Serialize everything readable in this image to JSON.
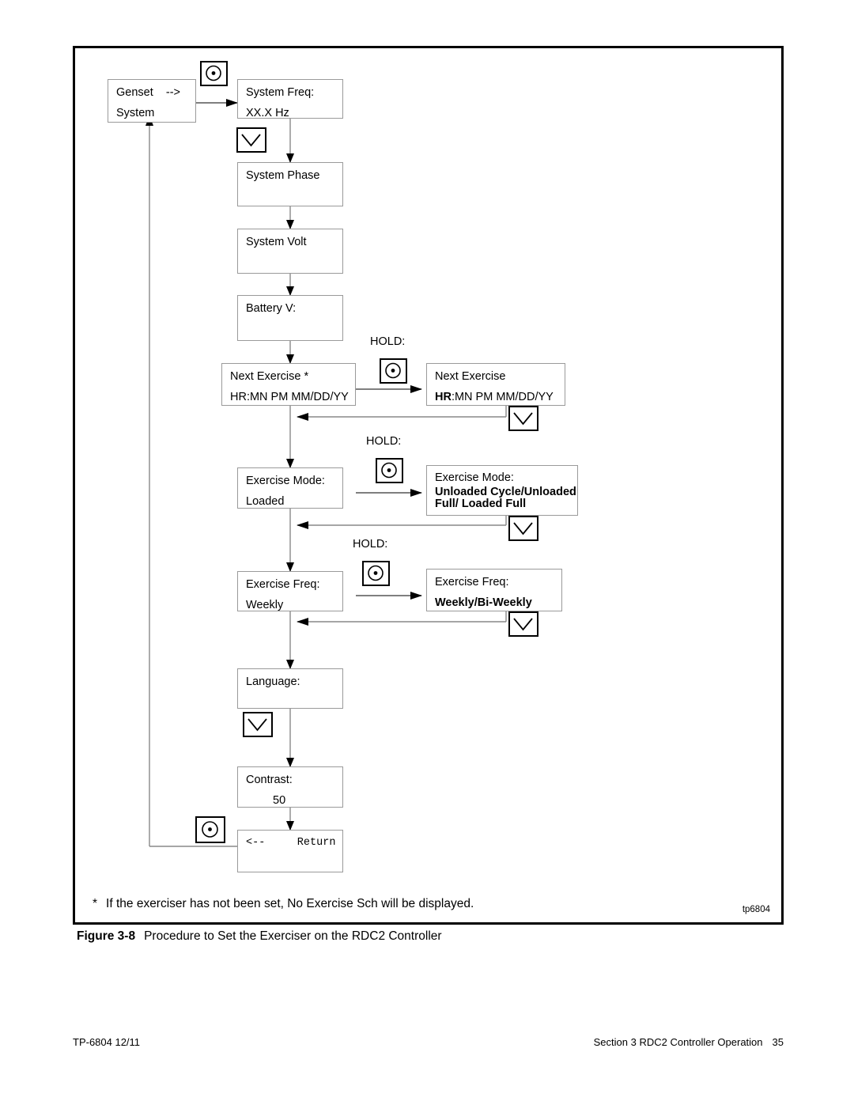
{
  "figure": {
    "caption_number": "Figure 3-8",
    "caption_text": "Procedure to Set the Exerciser on the RDC2 Controller",
    "drawing_id": "tp6804",
    "footnote_marker": "*",
    "footnote_text": "If the exerciser has not been set, No Exercise Sch will be displayed."
  },
  "footer": {
    "document_id": "TP-6804 12/11",
    "section": "Section 3  RDC2 Controller Operation",
    "page_number": "35"
  },
  "labels": {
    "hold_1": "HOLD:",
    "hold_2": "HOLD:",
    "hold_3": "HOLD:"
  },
  "icons": {
    "select_button": "circle-dot-icon",
    "down_button": "chevron-down-icon"
  },
  "boxes": {
    "genset": {
      "line1": "Genset    -->",
      "line2": "System"
    },
    "system_freq": {
      "line1": "System Freq:",
      "line2": "XX.X Hz"
    },
    "system_phase": {
      "line1": "System Phase",
      "line2": ""
    },
    "system_volt": {
      "line1": "System Volt",
      "line2": ""
    },
    "battery_v": {
      "line1": "Battery V:",
      "line2": ""
    },
    "next_exercise": {
      "line1": "Next Exercise *",
      "line2": "HR:MN PM MM/DD/YY"
    },
    "next_exercise_edit": {
      "line1": "Next Exercise",
      "line2_bold": "HR",
      "line2_rest": ":MN PM MM/DD/YY"
    },
    "exercise_mode": {
      "line1": "Exercise Mode:",
      "line2": "Loaded"
    },
    "exercise_mode_edit": {
      "line1": "Exercise Mode:",
      "line2_bold": "Unloaded Cycle/Unloaded",
      "line3_bold": "Full/ Loaded Full"
    },
    "exercise_freq": {
      "line1": "Exercise Freq:",
      "line2": "Weekly"
    },
    "exercise_freq_edit": {
      "line1": "Exercise Freq:",
      "line2_bold": "Weekly/Bi-Weekly"
    },
    "language": {
      "line1": "Language:",
      "line2": ""
    },
    "contrast": {
      "line1": "Contrast:",
      "line2": "50"
    },
    "return": {
      "line1": "<--     Return",
      "line2": ""
    }
  }
}
